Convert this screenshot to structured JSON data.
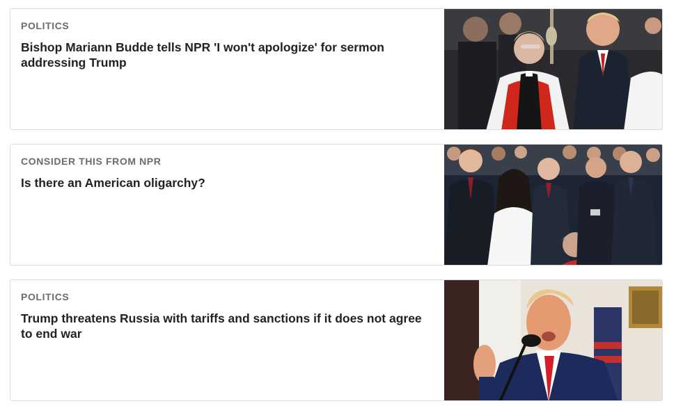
{
  "stories": [
    {
      "slug": "POLITICS",
      "headline": "Bishop Mariann Budde tells NPR 'I won't apologize' for sermon addressing Trump",
      "image_subject": "photo-bishop-and-trump-at-cathedral"
    },
    {
      "slug": "CONSIDER THIS FROM NPR",
      "headline": "Is there an American oligarchy?",
      "image_subject": "photo-tech-leaders-at-inauguration"
    },
    {
      "slug": "POLITICS",
      "headline": "Trump threatens Russia with tariffs and sanctions if it does not agree to end war",
      "image_subject": "photo-trump-speaking-at-podium"
    }
  ],
  "colors": {
    "slug": "#6b6b6b",
    "headline": "#222222",
    "card_border": "#dcdcdc"
  }
}
